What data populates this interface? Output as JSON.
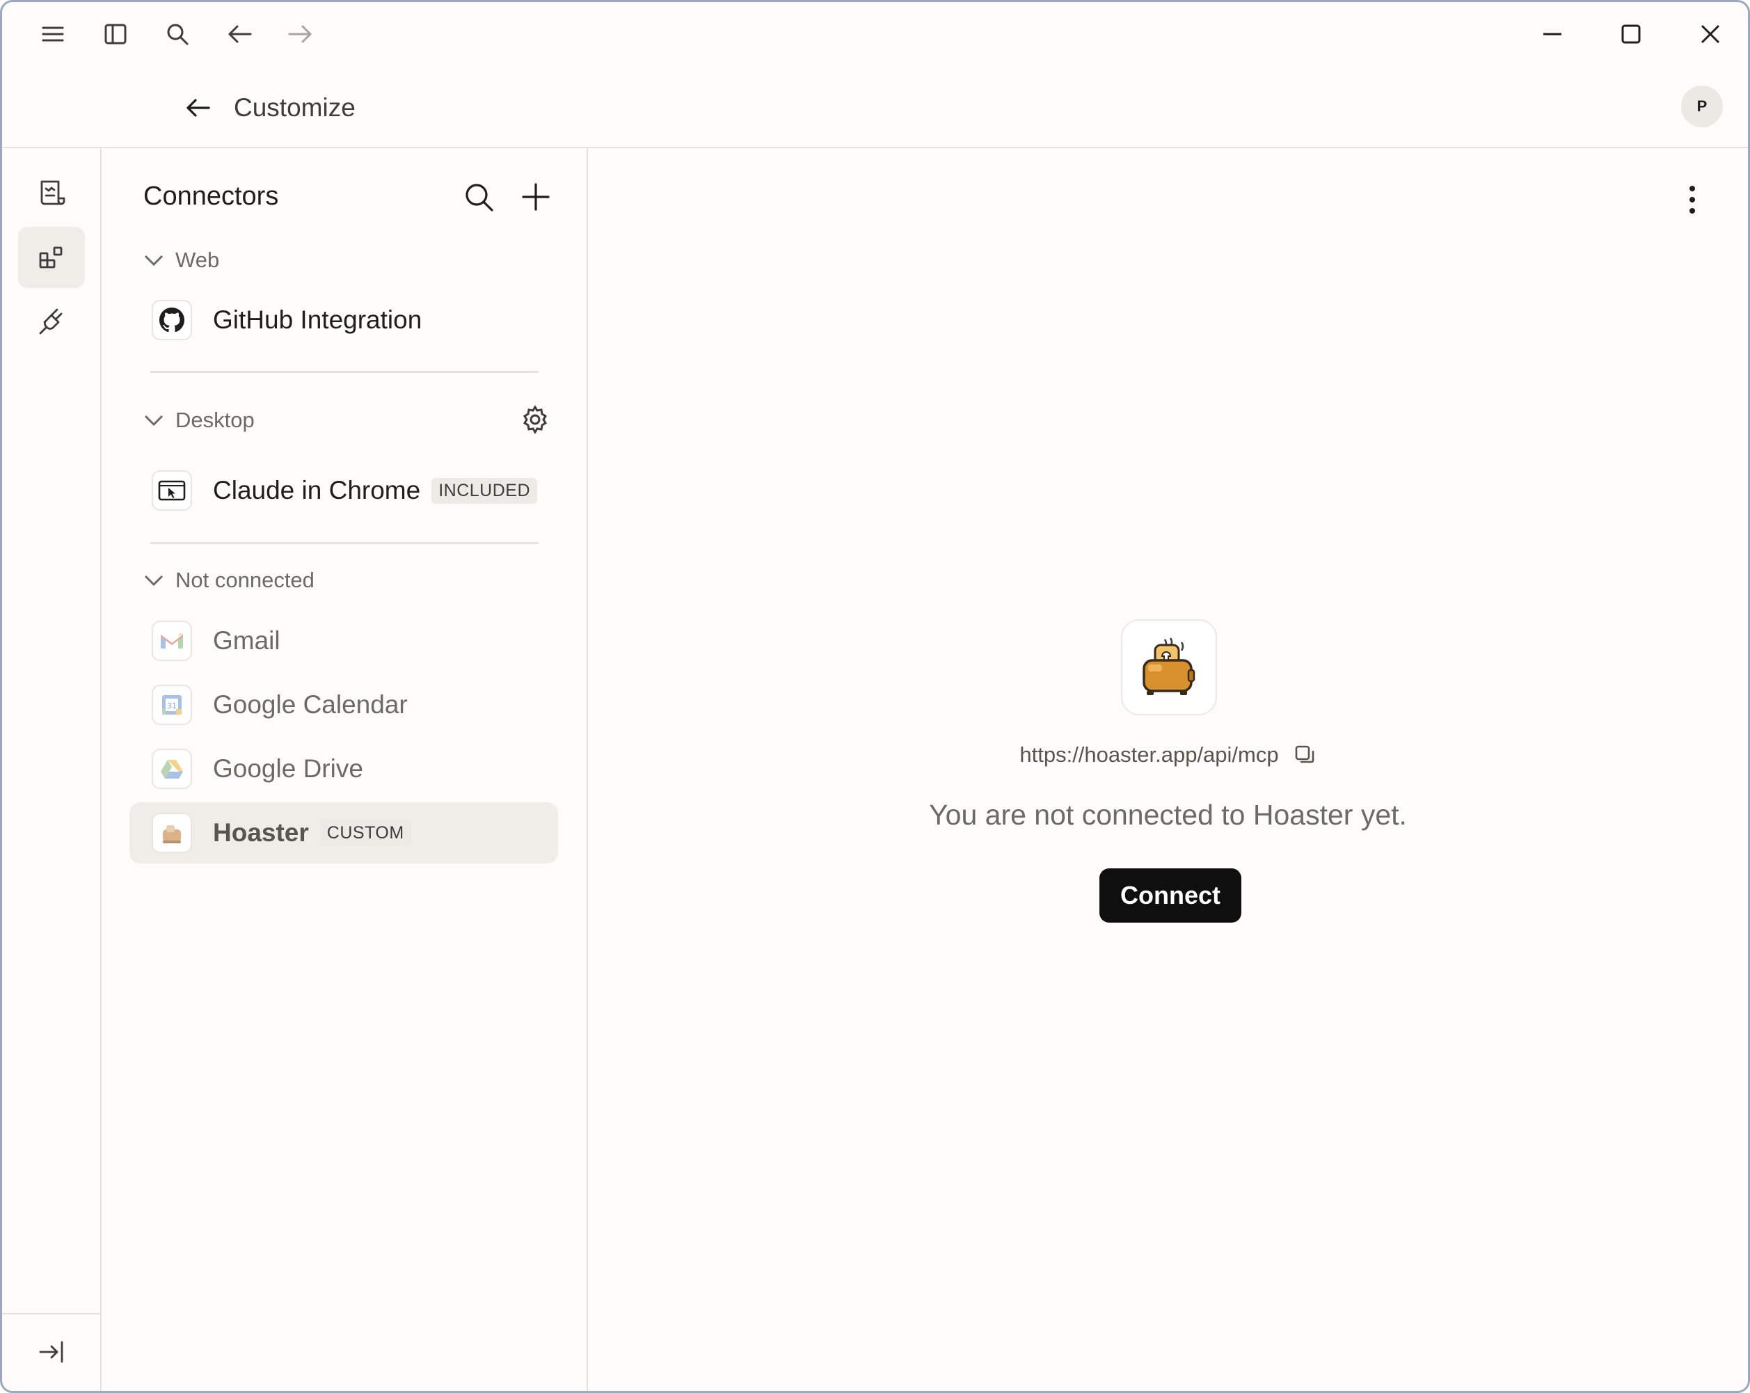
{
  "header": {
    "title": "Customize",
    "avatar_initial": "P"
  },
  "titlebar": {
    "icons": [
      "menu-icon",
      "sidebar-toggle-icon",
      "search-icon",
      "arrow-left-icon",
      "arrow-right-icon"
    ],
    "window_controls": [
      "minimize-icon",
      "maximize-icon",
      "close-icon"
    ]
  },
  "rail": {
    "items": [
      "scroll-icon",
      "connectors-icon",
      "plug-icon"
    ],
    "active_index": 1,
    "bottom": "collapse-sidebar-icon"
  },
  "panel": {
    "title": "Connectors",
    "sections": [
      {
        "label": "Web",
        "items": [
          {
            "label": "GitHub Integration",
            "icon": "github-icon"
          }
        ]
      },
      {
        "label": "Desktop",
        "items": [
          {
            "label": "Claude in Chrome",
            "badge": "INCLUDED",
            "icon": "chrome-cursor-icon"
          }
        ]
      },
      {
        "label": "Not connected",
        "items": [
          {
            "label": "Gmail",
            "icon": "gmail-icon"
          },
          {
            "label": "Google Calendar",
            "icon": "google-calendar-icon"
          },
          {
            "label": "Google Drive",
            "icon": "google-drive-icon"
          },
          {
            "label": "Hoaster",
            "badge": "CUSTOM",
            "icon": "toaster-icon",
            "selected": true
          }
        ]
      }
    ]
  },
  "main": {
    "url": "https://hoaster.app/api/mcp",
    "status": "You are not connected to Hoaster yet.",
    "connect_label": "Connect"
  },
  "colors": {
    "window_border": "#9aa9bf",
    "background": "#fdfcfa",
    "selected_bg": "#efede8",
    "button_bg": "#0f0f0f",
    "toaster_orange": "#d9902f"
  }
}
